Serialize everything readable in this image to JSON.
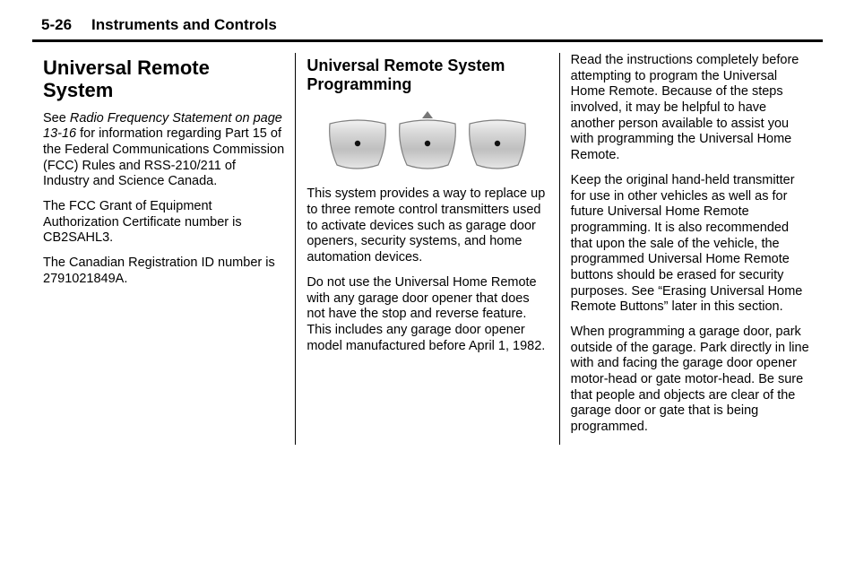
{
  "header": {
    "page_number": "5-26",
    "chapter_title": "Instruments and Controls"
  },
  "col1": {
    "h1": "Universal Remote System",
    "p1_lead": "See ",
    "p1_italic": "Radio Frequency Statement on page 13‑16",
    "p1_rest": " for information regarding Part 15 of the Federal Communications Commission (FCC) Rules and RSS-210/211 of Industry and Science Canada.",
    "p2": "The FCC Grant of Equipment Authorization Certificate number is CB2SAHL3.",
    "p3": "The Canadian Registration ID number is 2791021849A."
  },
  "col2": {
    "h2": "Universal Remote System Programming",
    "p1": "This system provides a way to replace up to three remote control transmitters used to activate devices such as garage door openers, security systems, and home automation devices.",
    "p2": "Do not use the Universal Home Remote with any garage door opener that does not have the stop and reverse feature. This includes any garage door opener model manufactured before April 1, 1982."
  },
  "col3": {
    "p1": "Read the instructions completely before attempting to program the Universal Home Remote. Because of the steps involved, it may be helpful to have another person available to assist you with programming the Universal Home Remote.",
    "p2": "Keep the original hand-held transmitter for use in other vehicles as well as for future Universal Home Remote programming. It is also recommended that upon the sale of the vehicle, the programmed Universal Home Remote buttons should be erased for security purposes. See “Erasing Universal Home Remote Buttons” later in this section.",
    "p3": "When programming a garage door, park outside of the garage. Park directly in line with and facing the garage door opener motor-head or gate motor-head. Be sure that people and objects are clear of the garage door or gate that is being programmed."
  },
  "illustration": {
    "name": "universal-remote-buttons-illustration"
  }
}
